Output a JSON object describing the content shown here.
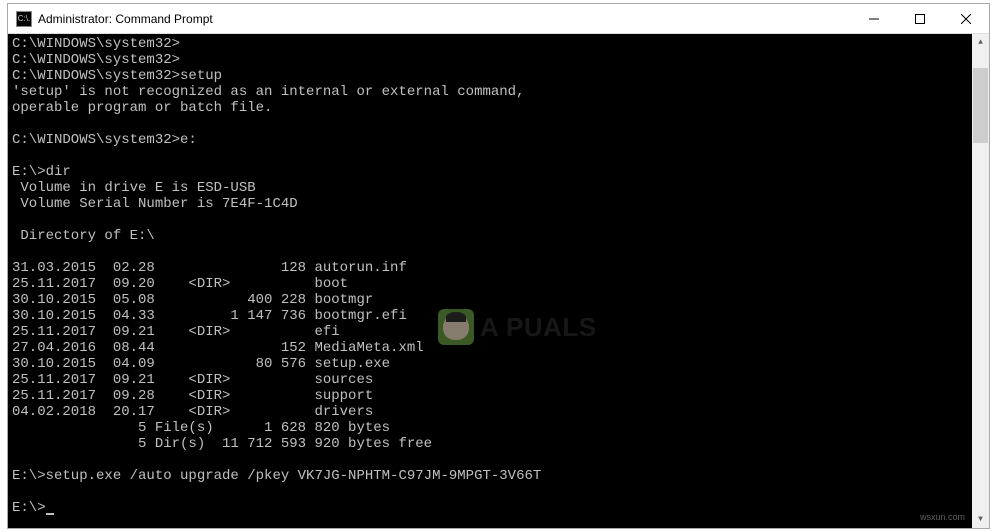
{
  "window": {
    "title": "Administrator: Command Prompt",
    "icon_label": "C:\\."
  },
  "terminal": {
    "lines": [
      "C:\\WINDOWS\\system32>",
      "C:\\WINDOWS\\system32>",
      "C:\\WINDOWS\\system32>setup",
      "'setup' is not recognized as an internal or external command,",
      "operable program or batch file.",
      "",
      "C:\\WINDOWS\\system32>e:",
      "",
      "E:\\>dir",
      " Volume in drive E is ESD-USB",
      " Volume Serial Number is 7E4F-1C4D",
      "",
      " Directory of E:\\",
      "",
      "31.03.2015  02.28               128 autorun.inf",
      "25.11.2017  09.20    <DIR>          boot",
      "30.10.2015  05.08           400 228 bootmgr",
      "30.10.2015  04.33         1 147 736 bootmgr.efi",
      "25.11.2017  09.21    <DIR>          efi",
      "27.04.2016  08.44               152 MediaMeta.xml",
      "30.10.2015  04.09            80 576 setup.exe",
      "25.11.2017  09.21    <DIR>          sources",
      "25.11.2017  09.28    <DIR>          support",
      "04.02.2018  20.17    <DIR>          drivers",
      "               5 File(s)      1 628 820 bytes",
      "               5 Dir(s)  11 712 593 920 bytes free",
      "",
      "E:\\>setup.exe /auto upgrade /pkey VK7JG-NPHTM-C97JM-9MPGT-3V66T",
      "",
      "E:\\>"
    ]
  },
  "watermark": {
    "text": "A PUALS",
    "secondary": "wsxun.com"
  }
}
